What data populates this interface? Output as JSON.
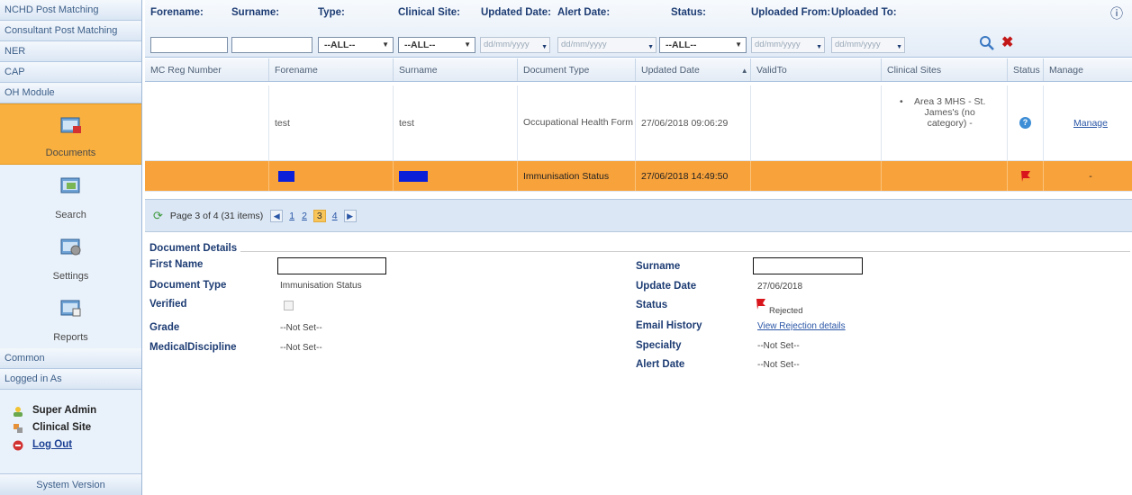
{
  "sidebar": {
    "sections": [
      "NCHD Post Matching",
      "Consultant Post Matching",
      "NER",
      "CAP",
      "OH Module"
    ],
    "oh_items": [
      {
        "label": "Documents",
        "icon": "documents-icon",
        "selected": true
      },
      {
        "label": "Search",
        "icon": "search-module-icon",
        "selected": false
      },
      {
        "label": "Settings",
        "icon": "settings-module-icon",
        "selected": false
      },
      {
        "label": "Reports",
        "icon": "reports-module-icon",
        "selected": false
      }
    ],
    "common": "Common",
    "logged_in_as": "Logged in As",
    "user": {
      "role": "Super Admin",
      "site": "Clinical Site",
      "logout": "Log Out"
    },
    "system_version": "System Version"
  },
  "filters": {
    "forename": "Forename:",
    "surname": "Surname:",
    "type": "Type:",
    "clinical_site": "Clinical Site:",
    "updated_date": "Updated Date:",
    "alert_date": "Alert Date:",
    "status": "Status:",
    "uploaded_from": "Uploaded From:",
    "uploaded_to": "Uploaded To:",
    "type_value": "--ALL--",
    "site_value": "--ALL--",
    "status_value": "--ALL--",
    "date_placeholder": "dd/mm/yyyy"
  },
  "grid": {
    "columns": [
      "MC Reg Number",
      "Forename",
      "Surname",
      "Document Type",
      "Updated Date",
      "ValidTo",
      "Clinical Sites",
      "Status",
      "Manage"
    ],
    "rows": [
      {
        "reg": "",
        "forename": "test",
        "surname": "test",
        "doc_type": "Occupational Health Form",
        "updated": "27/06/2018 09:06:29",
        "valid_to": "",
        "sites": "Area 3 MHS - St. James's (no category) -",
        "status_icon": "info-status-icon",
        "manage": "Manage"
      },
      {
        "reg": "",
        "forename": "",
        "surname": "",
        "doc_type": "Immunisation Status",
        "updated": "27/06/2018 14:49:50",
        "valid_to": "",
        "sites": "",
        "status_icon": "rejected-flag-icon",
        "manage": "-"
      }
    ],
    "pager": {
      "text": "Page 3 of 4 (31 items)",
      "pages": [
        "1",
        "2",
        "3",
        "4"
      ],
      "current": "3"
    }
  },
  "details": {
    "legend": "Document Details",
    "left": [
      {
        "label": "First Name",
        "value": ""
      },
      {
        "label": "Document Type",
        "value": "Immunisation Status"
      },
      {
        "label": "Verified",
        "value": ""
      },
      {
        "label": "Grade",
        "value": "--Not Set--"
      },
      {
        "label": "MedicalDiscipline",
        "value": "--Not Set--"
      }
    ],
    "right": [
      {
        "label": "Surname",
        "value": ""
      },
      {
        "label": "Update Date",
        "value": "27/06/2018"
      },
      {
        "label": "Status",
        "value": "Rejected"
      },
      {
        "label": "Email History",
        "value": "View Rejection details"
      },
      {
        "label": "Specialty",
        "value": "--Not Set--"
      },
      {
        "label": "Alert Date",
        "value": "--Not Set--"
      }
    ]
  },
  "colors": {
    "accent": "#f8a23b",
    "brand": "#1d3c73",
    "rejected": "#d8161c",
    "redaction": "#0b1fd8"
  }
}
